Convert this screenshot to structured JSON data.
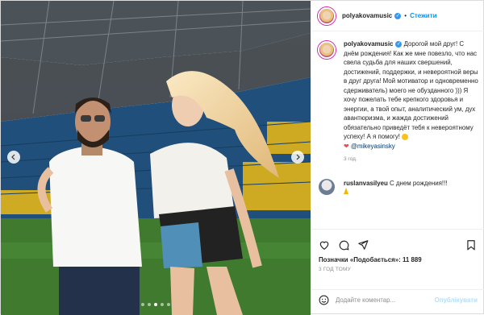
{
  "post": {
    "image_alt": "Photo of a man and a woman in a stadium",
    "carousel_dots": 5,
    "active_dot": 2
  },
  "header": {
    "username": "polyakovamusic",
    "verified_mark": "✓",
    "separator": "•",
    "follow_label": "Стежити"
  },
  "caption": {
    "username": "polyakovamusic",
    "text": " Дорогой мой друг! С днём рождения! Как же мне повезло, что нас свела судьба для наших свершений, достижений, поддержки, и невероятной веры в друг друга! Мой мотиватор и одновременно сдерживатель) моего не обузданного ))) Я хочу пожелать тебе крепкого здоровья и энергии, а твой опыт, аналитический ум, дух авантюризма, и жажда достижений обязательно приведёт тебя к невероятному успеху! А я помогу!",
    "heart": "❤",
    "mention": "@mikeyasinsky",
    "ago": "3 год."
  },
  "comment": {
    "username": "ruslanvasilyeu",
    "text": " С днем рождения!!!"
  },
  "actions": {
    "like_icon": "heart-outline-icon",
    "comment_icon": "comment-icon",
    "share_icon": "paper-plane-icon",
    "save_icon": "bookmark-icon"
  },
  "likes": "Позначки «Подобається»: 11 889",
  "timestamp": "3 ГОД ТОМУ",
  "composer": {
    "placeholder": "Додайте коментар...",
    "publish_label": "Опублікувати"
  }
}
